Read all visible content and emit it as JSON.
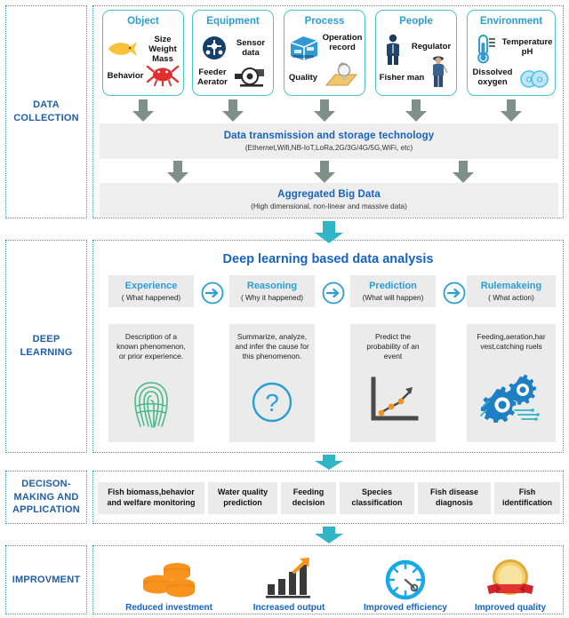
{
  "sections": [
    {
      "label": "DATA\nCOLLECTION"
    },
    {
      "label": "DEEP\nLEARNING"
    },
    {
      "label": "DECISON-\nMAKING AND\nAPPLICATION"
    },
    {
      "label": "IMPROVMENT"
    }
  ],
  "section_labels": {
    "data_collection_l1": "DATA",
    "data_collection_l2": "COLLECTION",
    "deep_learning_l1": "DEEP",
    "deep_learning_l2": "LEARNING",
    "decision_l1": "DECISON-",
    "decision_l2": "MAKING AND",
    "decision_l3": "APPLICATION",
    "improvement_l1": "IMPROVMENT"
  },
  "data_collection": {
    "cards": [
      {
        "title": "Object",
        "icon_a": "fish-icon",
        "text_a": "Size\nWeight\nMass",
        "text_a_lines": [
          "Size",
          "Weight",
          "Mass"
        ],
        "text_b": "Behavior",
        "icon_b": "crab-icon"
      },
      {
        "title": "Equipment",
        "icon_a": "sensor-icon",
        "text_a_lines": [
          "Sensor",
          "data"
        ],
        "text_b_lines": [
          "Feeder",
          "Aerator"
        ],
        "icon_b": "aerator-icon"
      },
      {
        "title": "Process",
        "icon_a": "server-icon",
        "text_a_lines": [
          "Operation",
          "record"
        ],
        "text_b_lines": [
          "Quality"
        ],
        "icon_b": "inspection-icon"
      },
      {
        "title": "People",
        "icon_a": "regulator-person-icon",
        "text_a_lines": [
          "Regulator"
        ],
        "text_b_lines": [
          "Fisher man"
        ],
        "icon_b": "fisherman-icon"
      },
      {
        "title": "Environment",
        "icon_a": "thermometer-icon",
        "text_a_lines": [
          "Temperature",
          "pH"
        ],
        "text_b_lines": [
          "Dissolved",
          "oxygen"
        ],
        "icon_b": "oxygen-bubbles-icon"
      }
    ],
    "transmission": {
      "title": "Data transmission and storage technology",
      "subtitle": "(Ethernet,Wifi,NB-IoT,LoRa,2G/3G/4G/5G,WiFi, etc)"
    },
    "aggregated": {
      "title": "Aggregated Big Data",
      "subtitle": "(High dimensional, non-linear and massive data)"
    }
  },
  "deep_learning": {
    "title": "Deep learning based data analysis",
    "stages": [
      {
        "head": "Experience",
        "sub": "( What happened)",
        "body_lines": [
          "Description of a",
          "known phenomenon,",
          "or prior experience."
        ],
        "icon": "fingerprint-icon"
      },
      {
        "head": "Reasoning",
        "sub": "( Why it happened)",
        "body_lines": [
          "Summarize, analyze,",
          "and infer the cause for",
          "this phenomenon."
        ],
        "icon": "question-mark-icon"
      },
      {
        "head": "Prediction",
        "sub": "(What will happen)",
        "body_lines": [
          "Predict the",
          "probability of an",
          "event"
        ],
        "icon": "trend-chart-icon"
      },
      {
        "head": "Rulemakeing",
        "sub": "( What action)",
        "body_lines": [
          "Feeding,aeration,har",
          "vest,catching ruels"
        ],
        "icon": "gears-circuit-icon"
      }
    ],
    "connector_icon": "arrow-right-circle-icon"
  },
  "decision": {
    "items": [
      {
        "lines": [
          "Fish biomass,behavior",
          "and welfare monitoring"
        ]
      },
      {
        "lines": [
          "Water quality",
          "prediction"
        ]
      },
      {
        "lines": [
          "Feeding",
          "decision"
        ]
      },
      {
        "lines": [
          "Species",
          "classification"
        ]
      },
      {
        "lines": [
          "Fish disease",
          "diagnosis"
        ]
      },
      {
        "lines": [
          "Fish",
          "identification"
        ]
      }
    ]
  },
  "improvement": {
    "items": [
      {
        "label": "Reduced investment",
        "icon": "coins-icon"
      },
      {
        "label": "Increased output",
        "icon": "bar-chart-up-icon"
      },
      {
        "label": "Improved efficiency",
        "icon": "clock-icon"
      },
      {
        "label": "Improved quality",
        "icon": "award-badge-icon"
      }
    ]
  },
  "colors": {
    "frame_dot": "#2a9fd6",
    "card_border": "#4ec3c9",
    "heading_blue": "#2a9fd6",
    "deep_blue": "#1763c0",
    "gray_panel": "#ebebeb",
    "gray_arrow": "#7f8f8a",
    "teal_arrow": "#2fb5c6",
    "orange": "#f0941f"
  }
}
